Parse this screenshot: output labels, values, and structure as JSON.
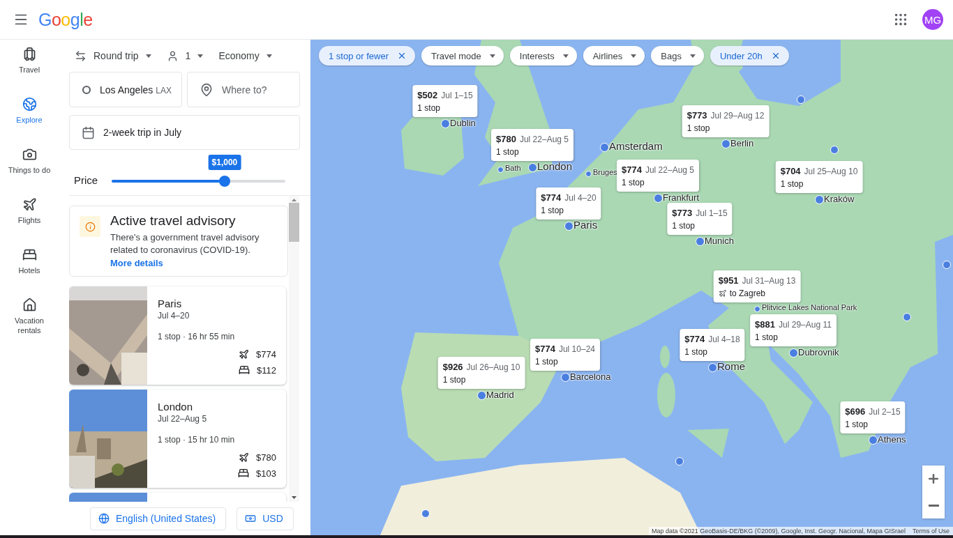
{
  "header": {
    "logo": "Google",
    "avatar": {
      "initials": "MG",
      "color": "#a142f4"
    }
  },
  "nav": [
    {
      "label": "Travel",
      "selected": false
    },
    {
      "label": "Explore",
      "selected": true
    },
    {
      "label": "Things to do",
      "selected": false
    },
    {
      "label": "Flights",
      "selected": false
    },
    {
      "label": "Hotels",
      "selected": false
    },
    {
      "label": "Vacation rentals",
      "selected": false
    }
  ],
  "trip_options": [
    {
      "label": "Round trip"
    },
    {
      "label": "1"
    },
    {
      "label": "Economy"
    }
  ],
  "origin": {
    "value": "Los Angeles",
    "code": "LAX"
  },
  "destination": {
    "placeholder": "Where to?"
  },
  "dates": {
    "value": "2-week trip in July"
  },
  "price": {
    "label": "Price",
    "tooltip": "$1,000",
    "level": 0.65
  },
  "advisory": {
    "title": "Active travel advisory",
    "text": "There's a government travel advisory related to coronavirus (COVID-19).",
    "link": "More details"
  },
  "destinations": [
    {
      "city": "Paris",
      "dates": "Jul 4–20",
      "summary": "1 stop · 16 hr 55 min",
      "flight_price": "$774",
      "hotel_price": "$112"
    },
    {
      "city": "London",
      "dates": "Jul 22–Aug 5",
      "summary": "1 stop · 15 hr 10 min",
      "flight_price": "$780",
      "hotel_price": "$103"
    }
  ],
  "footer": {
    "language": "English (United States)",
    "currency": "USD"
  },
  "filters": [
    {
      "label": "1 stop or fewer",
      "selected": true
    },
    {
      "label": "Travel mode",
      "selected": false
    },
    {
      "label": "Interests",
      "selected": false
    },
    {
      "label": "Airlines",
      "selected": false
    },
    {
      "label": "Bags",
      "selected": false
    },
    {
      "label": "Under 20h",
      "selected": true
    }
  ],
  "markers": [
    {
      "city": "Dublin",
      "kind": "city",
      "card": {
        "price": "$502",
        "dates": "Jul 1–15",
        "detail": "1 stop",
        "kind": "stops"
      }
    },
    {
      "city": "London",
      "kind": "major",
      "card": {
        "price": "$780",
        "dates": "Jul 22–Aug 5",
        "detail": "1 stop",
        "kind": "stops"
      }
    },
    {
      "city": "Amsterdam",
      "kind": "major"
    },
    {
      "city": "Bath",
      "kind": "minor"
    },
    {
      "city": "Bruges",
      "kind": "minor"
    },
    {
      "city": "Berlin",
      "kind": "city",
      "card": {
        "price": "$773",
        "dates": "Jul 29–Aug 12",
        "detail": "1 stop",
        "kind": "stops"
      }
    },
    {
      "city": "Frankfurt",
      "kind": "city",
      "card": {
        "price": "$774",
        "dates": "Jul 22–Aug 5",
        "detail": "1 stop",
        "kind": "stops"
      }
    },
    {
      "city": "Kraków",
      "kind": "city",
      "card": {
        "price": "$704",
        "dates": "Jul 25–Aug 10",
        "detail": "1 stop",
        "kind": "stops"
      }
    },
    {
      "city": "Paris",
      "kind": "major",
      "card": {
        "price": "$774",
        "dates": "Jul 4–20",
        "detail": "1 stop",
        "kind": "stops"
      }
    },
    {
      "city": "Munich",
      "kind": "city",
      "card": {
        "price": "$773",
        "dates": "Jul 1–15",
        "detail": "1 stop",
        "kind": "stops"
      }
    },
    {
      "city": "Plitvice Lakes National Park",
      "kind": "minor",
      "card": {
        "price": "$951",
        "dates": "Jul 31–Aug 13",
        "detail": "to Zagreb",
        "kind": "connection"
      }
    },
    {
      "city": "Dubrovnik",
      "kind": "city",
      "card": {
        "price": "$881",
        "dates": "Jul 29–Aug 11",
        "detail": "1 stop",
        "kind": "stops"
      }
    },
    {
      "city": "Rome",
      "kind": "major",
      "card": {
        "price": "$774",
        "dates": "Jul 4–18",
        "detail": "1 stop",
        "kind": "stops"
      }
    },
    {
      "city": "Barcelona",
      "kind": "city",
      "card": {
        "price": "$774",
        "dates": "Jul 10–24",
        "detail": "1 stop",
        "kind": "stops"
      }
    },
    {
      "city": "Madrid",
      "kind": "city",
      "card": {
        "price": "$926",
        "dates": "Jul 26–Aug 10",
        "detail": "1 stop",
        "kind": "stops"
      }
    },
    {
      "city": "Athens",
      "kind": "city",
      "card": {
        "price": "$696",
        "dates": "Jul 2–15",
        "detail": "1 stop",
        "kind": "stops"
      }
    }
  ],
  "attribution": {
    "text": "Map data ©2021 GeoBasis-DE/BKG (©2009), Google, Inst. Geogr. Nacional, Mapa GISrael",
    "terms": "Terms of Use"
  }
}
